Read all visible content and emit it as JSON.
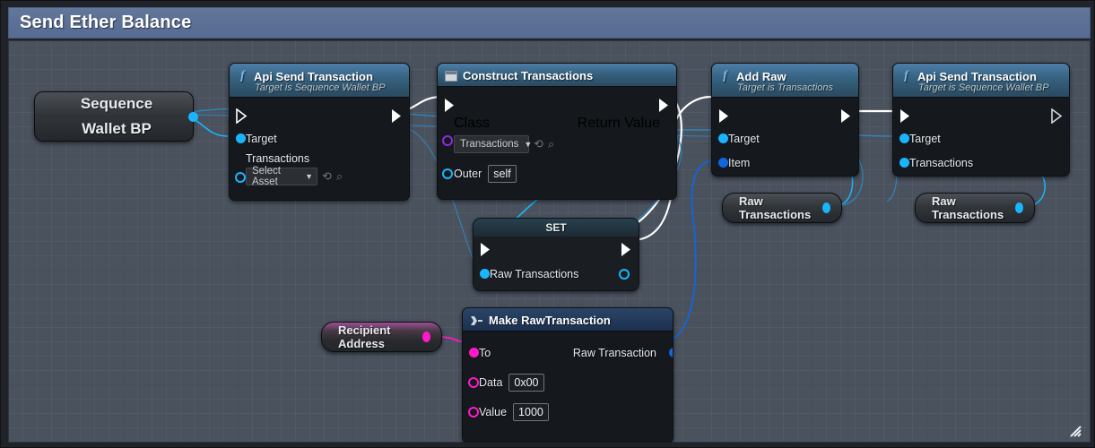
{
  "window": {
    "title": "Send Ether Balance"
  },
  "colors": {
    "titlebar": "#5c7096",
    "canvas": "#4a525e",
    "exec_wire": "#ffffff",
    "object_wire": "#19b6ff",
    "struct_wire": "#1166e0",
    "string_wire": "#ff19c8",
    "pin_object": "#19b6ff",
    "pin_struct": "#1166e0",
    "pin_string": "#ff19c8",
    "pin_class": "#8a2be2",
    "node_header_fn": "#36617f",
    "node_body": "#15181c"
  },
  "nodes": [
    {
      "id": "sequence-wallet-bp",
      "kind": "variable-get",
      "label_line1": "Sequence",
      "label_line2": "Wallet BP",
      "out_pin": "object"
    },
    {
      "id": "api-send-transaction-1",
      "kind": "function",
      "icon": "function-icon",
      "title": "Api Send Transaction",
      "subtitle": "Target is Sequence Wallet BP",
      "pins_in": [
        {
          "name": "exec",
          "label": "",
          "type": "exec"
        },
        {
          "name": "Target",
          "label": "Target",
          "type": "object"
        },
        {
          "name": "Transactions",
          "label": "Transactions",
          "type": "object-array"
        }
      ],
      "pins_out": [
        {
          "name": "exec",
          "label": "",
          "type": "exec"
        }
      ],
      "widget": {
        "type": "asset-picker",
        "value": "Select Asset",
        "chevron": "chevron-down-icon",
        "browse": "browse-icon",
        "search": "search-icon"
      }
    },
    {
      "id": "construct-transactions",
      "kind": "construct-object",
      "icon": "window-icon",
      "title": "Construct Transactions",
      "subtitle": "",
      "pins_in": [
        {
          "name": "exec",
          "label": "",
          "type": "exec"
        },
        {
          "name": "Class",
          "label": "Class",
          "type": "class"
        },
        {
          "name": "Outer",
          "label": "Outer",
          "type": "object"
        }
      ],
      "pins_out": [
        {
          "name": "exec",
          "label": "",
          "type": "exec"
        },
        {
          "name": "ReturnValue",
          "label": "Return Value",
          "type": "object"
        }
      ],
      "widget": {
        "type": "class-picker",
        "value": "Transactions",
        "chevron": "chevron-down-icon",
        "browse": "browse-icon",
        "search": "search-icon"
      },
      "outer_value": "self"
    },
    {
      "id": "add-raw",
      "kind": "function",
      "icon": "function-icon",
      "title": "Add Raw",
      "subtitle": "Target is Transactions",
      "pins_in": [
        {
          "name": "exec",
          "label": "",
          "type": "exec"
        },
        {
          "name": "Target",
          "label": "Target",
          "type": "object"
        },
        {
          "name": "Item",
          "label": "Item",
          "type": "struct"
        }
      ],
      "pins_out": [
        {
          "name": "exec",
          "label": "",
          "type": "exec"
        }
      ]
    },
    {
      "id": "api-send-transaction-2",
      "kind": "function",
      "icon": "function-icon",
      "title": "Api Send Transaction",
      "subtitle": "Target is Sequence Wallet BP",
      "pins_in": [
        {
          "name": "exec",
          "label": "",
          "type": "exec"
        },
        {
          "name": "Target",
          "label": "Target",
          "type": "object"
        },
        {
          "name": "Transactions",
          "label": "Transactions",
          "type": "object"
        }
      ],
      "pins_out": [
        {
          "name": "exec",
          "label": "",
          "type": "exec-unconnected"
        }
      ]
    },
    {
      "id": "set-raw-transactions",
      "kind": "set-variable",
      "title": "SET",
      "pins_in": [
        {
          "name": "exec",
          "label": "",
          "type": "exec"
        },
        {
          "name": "RawTransactions",
          "label": "Raw Transactions",
          "type": "object"
        }
      ],
      "pins_out": [
        {
          "name": "exec",
          "label": "",
          "type": "exec"
        },
        {
          "name": "RawTransactionsOut",
          "label": "",
          "type": "object-ref"
        }
      ]
    },
    {
      "id": "make-rawtransaction",
      "kind": "make-struct",
      "icon": "make-struct-icon",
      "title": "Make RawTransaction",
      "pins_in": [
        {
          "name": "To",
          "label": "To",
          "type": "string"
        },
        {
          "name": "Data",
          "label": "Data",
          "type": "string",
          "value": "0x00"
        },
        {
          "name": "Value",
          "label": "Value",
          "type": "string",
          "value": "1000"
        }
      ],
      "pins_out": [
        {
          "name": "RawTransaction",
          "label": "Raw Transaction",
          "type": "struct"
        }
      ]
    },
    {
      "id": "raw-transactions-get-1",
      "kind": "variable-get",
      "label": "Raw Transactions",
      "out_pin": "object"
    },
    {
      "id": "raw-transactions-get-2",
      "kind": "variable-get",
      "label": "Raw Transactions",
      "out_pin": "object"
    },
    {
      "id": "recipient-address",
      "kind": "variable-get",
      "label": "Recipient Address",
      "out_pin": "string"
    }
  ],
  "labels": {
    "sequence_wallet_l1": "Sequence",
    "sequence_wallet_l2": "Wallet BP",
    "api1_title": "Api Send Transaction",
    "api1_sub": "Target is Sequence Wallet BP",
    "api1_target": "Target",
    "api1_transactions": "Transactions",
    "api1_select_asset": "Select Asset",
    "ct_title": "Construct Transactions",
    "ct_class": "Class",
    "ct_class_value": "Transactions",
    "ct_outer": "Outer",
    "ct_outer_value": "self",
    "ct_return": "Return Value",
    "ar_title": "Add Raw",
    "ar_sub": "Target is Transactions",
    "ar_target": "Target",
    "ar_item": "Item",
    "api2_title": "Api Send Transaction",
    "api2_sub": "Target is Sequence Wallet BP",
    "api2_target": "Target",
    "api2_transactions": "Transactions",
    "set_title": "SET",
    "set_var": "Raw Transactions",
    "mk_title": "Make RawTransaction",
    "mk_to": "To",
    "mk_data": "Data",
    "mk_data_value": "0x00",
    "mk_value": "Value",
    "mk_value_value": "1000",
    "mk_return": "Raw Transaction",
    "rawtx1": "Raw Transactions",
    "rawtx2": "Raw Transactions",
    "recipient": "Recipient Address"
  }
}
